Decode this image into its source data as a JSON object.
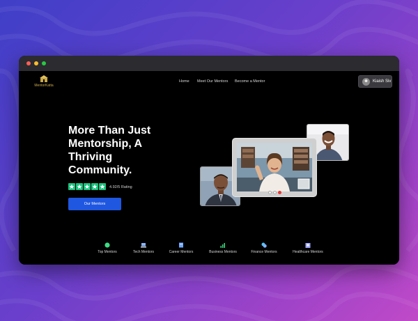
{
  "brand": {
    "logo_text": "MentorKatta",
    "accent": "#c9a84a"
  },
  "nav": {
    "items": [
      {
        "label": "Home"
      },
      {
        "label": "Meet Our Mentors"
      },
      {
        "label": "Become a Mentor"
      }
    ]
  },
  "user": {
    "name": "Kiaish Siv",
    "avatar_icon": "user-avatar"
  },
  "hero": {
    "headline_lines": [
      "More Than Just",
      "Mentorship, A",
      "Thriving",
      "Community."
    ],
    "rating_stars": 5,
    "rating_text": "4.92/5 Rating",
    "star_color": "#19c37d",
    "cta_label": "Our Mentors",
    "cta_color": "#1f57e0"
  },
  "video_call": {
    "buttons": [
      "mute-icon",
      "camera-icon",
      "end-call-icon"
    ]
  },
  "categories": [
    {
      "label": "Top Mentors",
      "icon": "trophy-icon",
      "color": "#3ddc84"
    },
    {
      "label": "Tech Mentors",
      "icon": "laptop-icon",
      "color": "#8ab4f8"
    },
    {
      "label": "Career Mentors",
      "icon": "briefcase-icon",
      "color": "#6fa8ff"
    },
    {
      "label": "Business Mentors",
      "icon": "chart-icon",
      "color": "#3ddc84"
    },
    {
      "label": "Finance Mentors",
      "icon": "coins-icon",
      "color": "#4fc3f7"
    },
    {
      "label": "Healthcare Mentors",
      "icon": "hospital-icon",
      "color": "#9fa8ff"
    }
  ],
  "window_controls": [
    "close",
    "minimize",
    "maximize"
  ]
}
